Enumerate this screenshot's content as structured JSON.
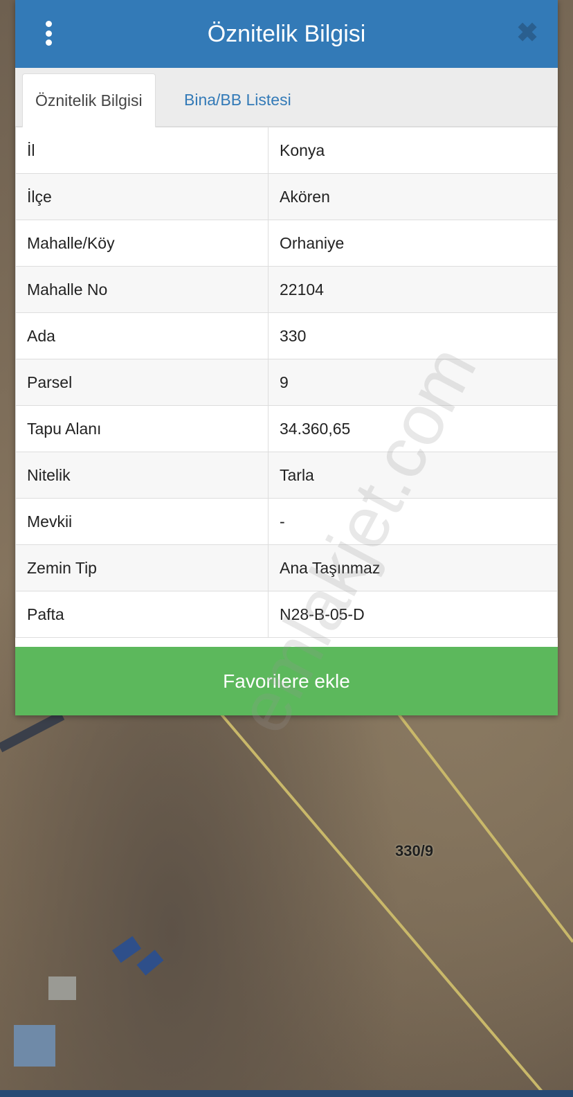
{
  "dialog": {
    "title": "Öznitelik Bilgisi",
    "tabs": [
      {
        "label": "Öznitelik Bilgisi",
        "active": true
      },
      {
        "label": "Bina/BB Listesi",
        "active": false
      }
    ],
    "rows": [
      {
        "key": "İl",
        "value": "Konya"
      },
      {
        "key": "İlçe",
        "value": "Akören"
      },
      {
        "key": "Mahalle/Köy",
        "value": "Orhaniye"
      },
      {
        "key": "Mahalle No",
        "value": "22104"
      },
      {
        "key": "Ada",
        "value": "330"
      },
      {
        "key": "Parsel",
        "value": "9"
      },
      {
        "key": "Tapu Alanı",
        "value": "34.360,65"
      },
      {
        "key": "Nitelik",
        "value": "Tarla"
      },
      {
        "key": "Mevkii",
        "value": "-"
      },
      {
        "key": "Zemin Tip",
        "value": "Ana Taşınmaz"
      },
      {
        "key": "Pafta",
        "value": "N28-B-05-D"
      }
    ],
    "favorite_button": "Favorilere ekle",
    "icons": {
      "menu": "vertical-dots-icon",
      "close": "close-icon"
    },
    "colors": {
      "header": "#337ab7",
      "button": "#5cb85c",
      "link": "#337ab7"
    }
  },
  "map": {
    "parcel_label": "330/9"
  },
  "watermark": "emlakjet.com"
}
